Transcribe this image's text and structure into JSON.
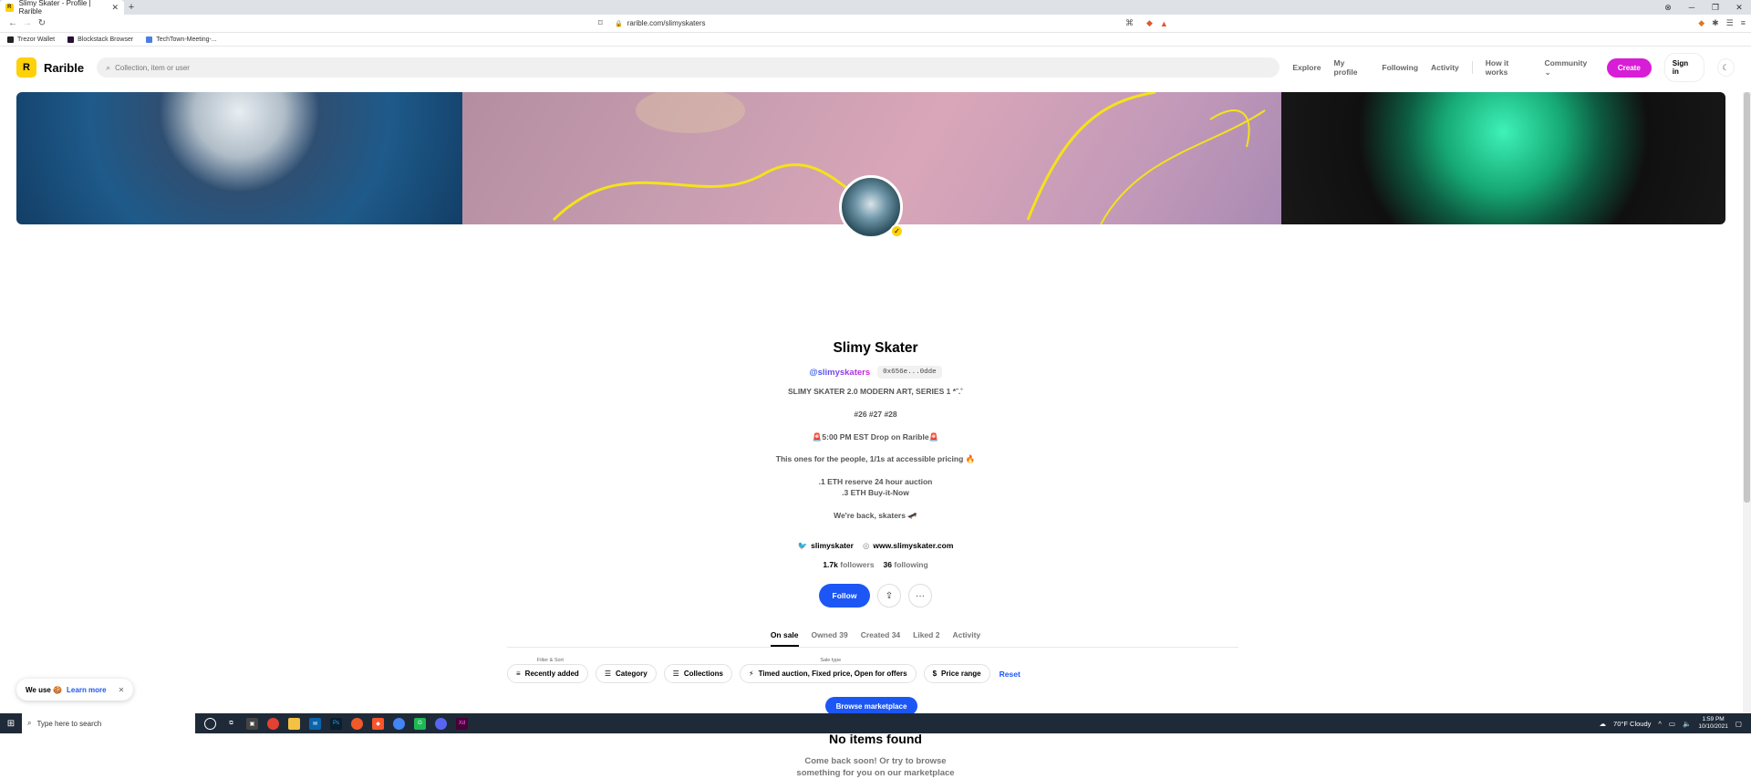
{
  "browser": {
    "tab_title": "Slimy Skater - Profile | Rarible",
    "url": "rarible.com/slimyskaters",
    "bookmarks": [
      "Trezor Wallet",
      "Blockstack Browser",
      "TechTown-Meeting-..."
    ]
  },
  "header": {
    "brand": "Rarible",
    "search_placeholder": "Collection, item or user",
    "nav": [
      "Explore",
      "My profile",
      "Following",
      "Activity",
      "How it works",
      "Community"
    ],
    "create_label": "Create",
    "signin_label": "Sign in"
  },
  "profile": {
    "name": "Slimy Skater",
    "handle": "@slimyskaters",
    "address": "0x656e...0dde",
    "bio": [
      "SLIMY SKATER 2.0 MODERN ART, SERIES 1 *˜.˚",
      "#26 #27 #28",
      "🚨5:00 PM EST Drop on Rarible🚨",
      "This ones for the people, 1/1s at accessible pricing 🔥",
      ".1 ETH reserve 24 hour auction",
      ".3 ETH Buy-it-Now",
      "We're back, skaters 🛹"
    ],
    "twitter": "slimyskater",
    "website": "www.slimyskater.com",
    "followers_count": "1.7k",
    "followers_label": "followers",
    "following_count": "36",
    "following_label": "following",
    "follow_label": "Follow"
  },
  "tabs": [
    "On sale",
    "Owned 39",
    "Created 34",
    "Liked 2",
    "Activity"
  ],
  "filters": {
    "sort_group_label": "Filter & Sort",
    "sort_value": "Recently added",
    "category": "Category",
    "collections": "Collections",
    "sale_type_label": "Sale type",
    "sale_type_value": "Timed auction, Fixed price, Open for offers",
    "price_range": "Price range",
    "reset": "Reset"
  },
  "empty": {
    "title": "No items found",
    "subtitle_line1": "Come back soon! Or try to browse",
    "subtitle_line2": "something for you on our marketplace",
    "cta": "Browse marketplace"
  },
  "cookie": {
    "text": "We use 🍪",
    "link": "Learn more"
  },
  "taskbar": {
    "search_placeholder": "Type here to search",
    "weather": "70°F  Cloudy",
    "time": "1:59 PM",
    "date": "10/10/2021"
  },
  "colors": {
    "accent_blue": "#1c57f5",
    "create_pink": "#d81dd6",
    "brand_yellow": "#fed10a"
  }
}
